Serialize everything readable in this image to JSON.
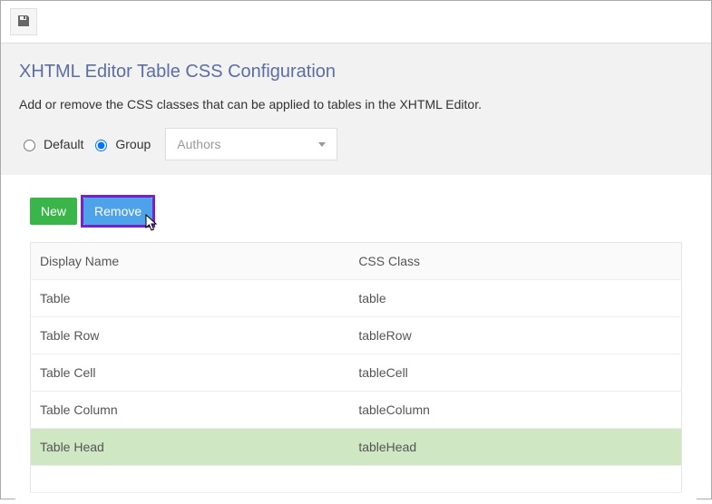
{
  "page": {
    "title": "XHTML Editor Table CSS Configuration",
    "description": "Add or remove the CSS classes that can be applied to tables in the XHTML Editor."
  },
  "scope": {
    "default_label": "Default",
    "group_label": "Group",
    "selected": "group",
    "group_value": "Authors"
  },
  "actions": {
    "new_label": "New",
    "remove_label": "Remove"
  },
  "table": {
    "headers": {
      "display_name": "Display Name",
      "css_class": "CSS Class"
    },
    "rows": [
      {
        "display_name": "Table",
        "css_class": "table",
        "selected": false
      },
      {
        "display_name": "Table Row",
        "css_class": "tableRow",
        "selected": false
      },
      {
        "display_name": "Table Cell",
        "css_class": "tableCell",
        "selected": false
      },
      {
        "display_name": "Table Column",
        "css_class": "tableColumn",
        "selected": false
      },
      {
        "display_name": "Table Head",
        "css_class": "tableHead",
        "selected": true
      }
    ]
  }
}
